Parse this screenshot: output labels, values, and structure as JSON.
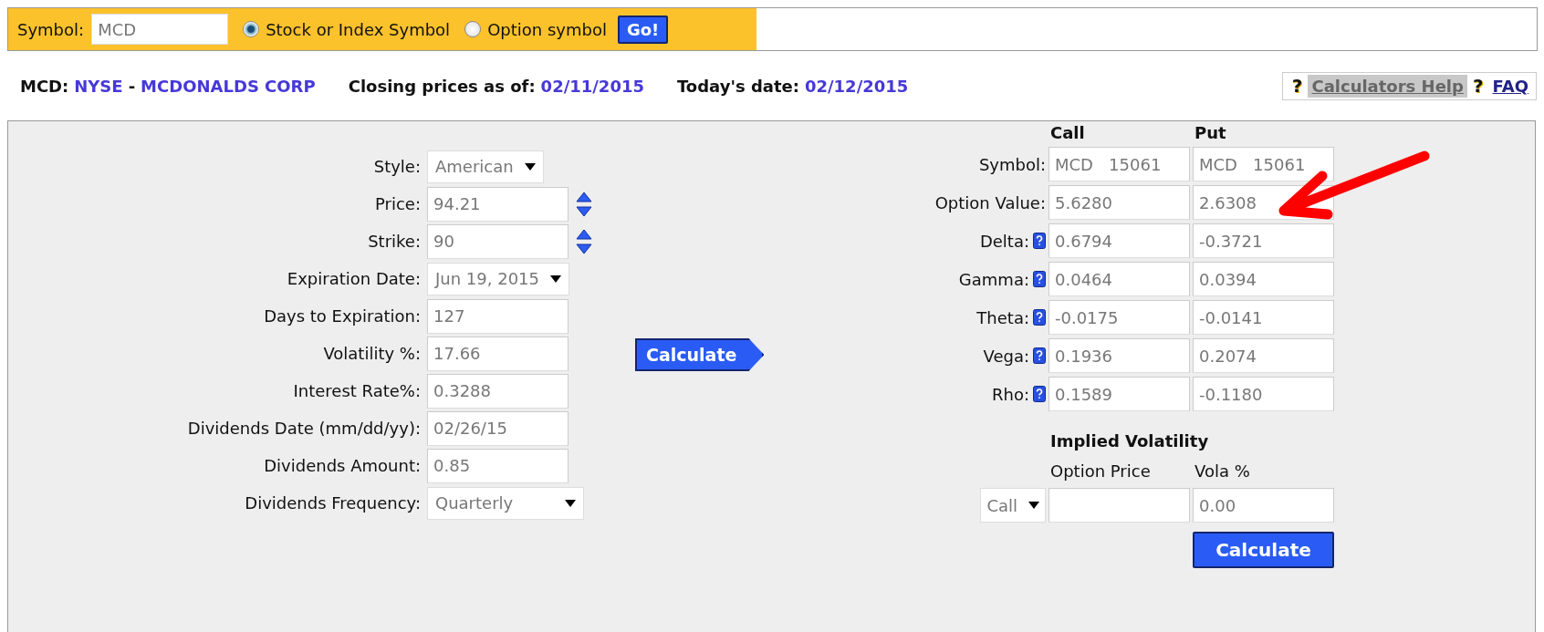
{
  "symbol_bar": {
    "label": "Symbol:",
    "value": "MCD",
    "options": [
      {
        "label": "Stock or Index Symbol",
        "selected": true
      },
      {
        "label": "Option symbol",
        "selected": false
      }
    ],
    "go_button": "Go!"
  },
  "info": {
    "symbol": "MCD:",
    "exchange": "NYSE",
    "separator": "-",
    "company": "MCDONALDS CORP",
    "closing_label": "Closing prices as of:",
    "closing_date": "02/11/2015",
    "today_label": "Today's date:",
    "today_date": "02/12/2015"
  },
  "help_links": [
    {
      "icon": "?",
      "label": "Calculators Help",
      "highlighted": true
    },
    {
      "icon": "?",
      "label": "FAQ",
      "highlighted": false
    }
  ],
  "inputs": [
    {
      "label": "Style:",
      "value": "American",
      "kind": "select"
    },
    {
      "label": "Price:",
      "value": "94.21",
      "kind": "spinner"
    },
    {
      "label": "Strike:",
      "value": "90",
      "kind": "spinner"
    },
    {
      "label": "Expiration Date:",
      "value": "Jun 19, 2015",
      "kind": "select"
    },
    {
      "label": "Days to Expiration:",
      "value": "127",
      "kind": "text"
    },
    {
      "label": "Volatility %:",
      "value": "17.66",
      "kind": "text"
    },
    {
      "label": "Interest Rate%:",
      "value": "0.3288",
      "kind": "text"
    },
    {
      "label": "Dividends Date (mm/dd/yy):",
      "value": "02/26/15",
      "kind": "text"
    },
    {
      "label": "Dividends Amount:",
      "value": "0.85",
      "kind": "text"
    },
    {
      "label": "Dividends Frequency:",
      "value": "Quarterly",
      "kind": "select-wide"
    }
  ],
  "calculate_button": "Calculate",
  "results": {
    "columns": [
      "Call",
      "Put"
    ],
    "rows": [
      {
        "label": "Symbol:",
        "help": false,
        "call": "MCD   15061",
        "put": "MCD   15061"
      },
      {
        "label": "Option Value:",
        "help": false,
        "call": "5.6280",
        "put": "2.6308"
      },
      {
        "label": "Delta:",
        "help": true,
        "call": "0.6794",
        "put": "-0.3721"
      },
      {
        "label": "Gamma:",
        "help": true,
        "call": "0.0464",
        "put": "0.0394"
      },
      {
        "label": "Theta:",
        "help": true,
        "call": "-0.0175",
        "put": "-0.0141"
      },
      {
        "label": "Vega:",
        "help": true,
        "call": "0.1936",
        "put": "0.2074"
      },
      {
        "label": "Rho:",
        "help": true,
        "call": "0.1589",
        "put": "-0.1180"
      }
    ]
  },
  "implied_volatility": {
    "title": "Implied Volatility",
    "columns": [
      "Option Price",
      "Vola %"
    ],
    "type": "Call",
    "vola": "0.00",
    "button": "Calculate"
  }
}
